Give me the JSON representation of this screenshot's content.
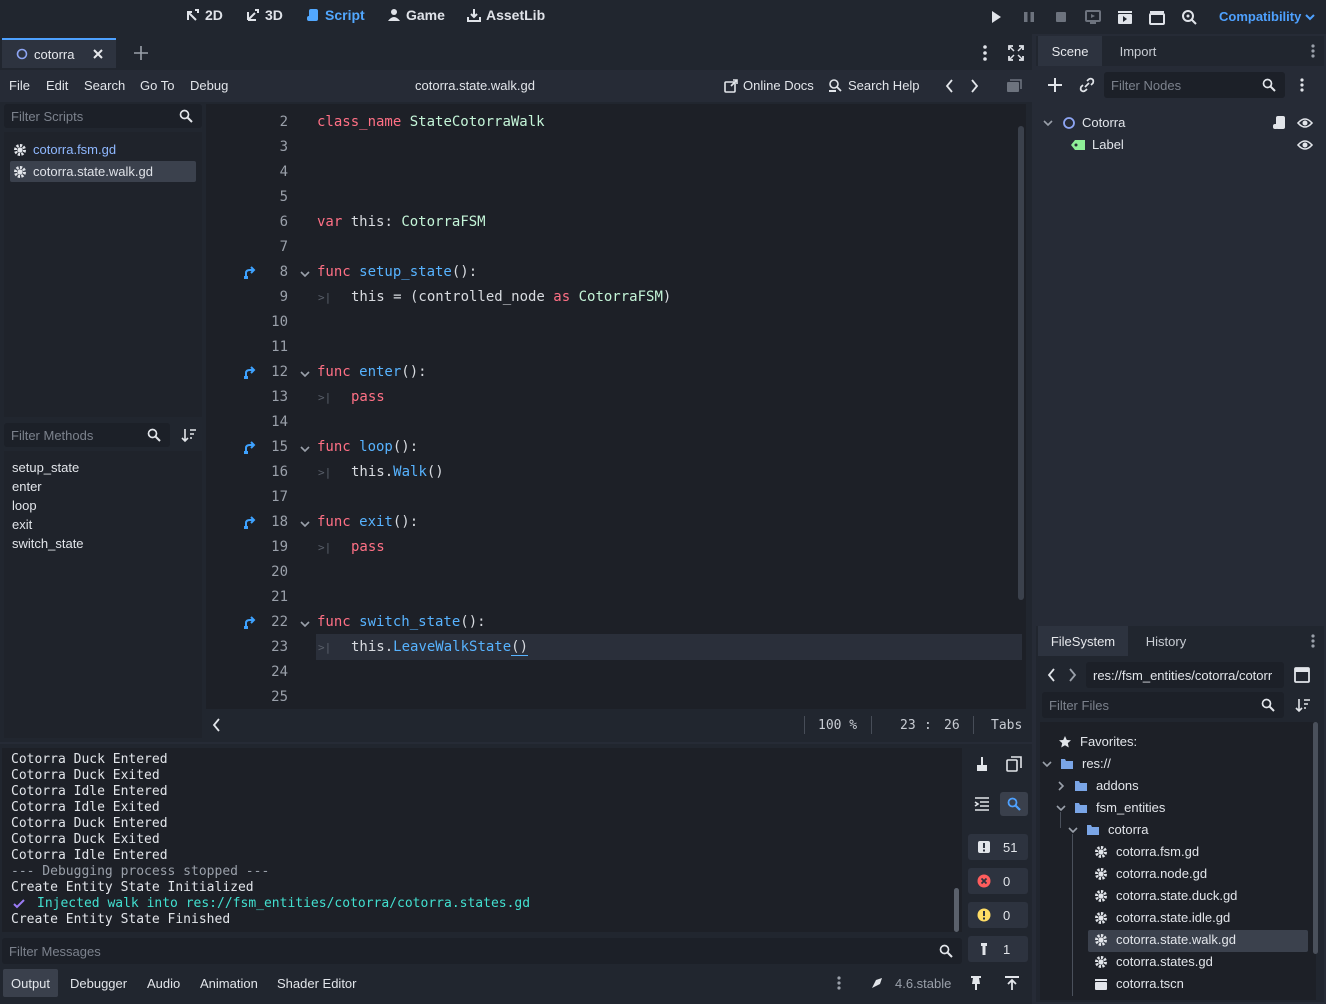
{
  "topbar": {
    "modes": [
      {
        "label": "2D",
        "icon": "2d-icon"
      },
      {
        "label": "3D",
        "icon": "3d-icon"
      },
      {
        "label": "Script",
        "icon": "script-icon"
      },
      {
        "label": "Game",
        "icon": "game-icon"
      },
      {
        "label": "AssetLib",
        "icon": "assetlib-icon"
      }
    ],
    "active_mode": "Script",
    "renderer": "Compatibility"
  },
  "script_editor": {
    "open_tab": "cotorra",
    "menu": [
      "File",
      "Edit",
      "Search",
      "Go To",
      "Debug"
    ],
    "current_file": "cotorra.state.walk.gd",
    "online_docs": "Online Docs",
    "search_help": "Search Help",
    "filter_scripts_placeholder": "Filter Scripts",
    "scripts": [
      "cotorra.fsm.gd",
      "cotorra.state.walk.gd"
    ],
    "filter_methods_placeholder": "Filter Methods",
    "methods": [
      "setup_state",
      "enter",
      "loop",
      "exit",
      "switch_state"
    ],
    "line_numbers": [
      "2",
      "3",
      "4",
      "5",
      "6",
      "7",
      "8",
      "9",
      "10",
      "11",
      "12",
      "13",
      "14",
      "15",
      "16",
      "17",
      "18",
      "19",
      "20",
      "21",
      "22",
      "23",
      "24",
      "25"
    ],
    "code": {
      "l2_kw": "class_name",
      "l2_name": " StateCotorraWalk",
      "l6_kw": "var",
      "l6_rest": " this: ",
      "l6_type": "CotorraFSM",
      "l8_kw": "func",
      "l8_fn": " setup_state",
      "l8_rest": "():",
      "l9_a": "this = (controlled_node ",
      "l9_as": "as",
      "l9_type": " CotorraFSM",
      "l9_end": ")",
      "l12_kw": "func",
      "l12_fn": " enter",
      "l12_rest": "():",
      "l13_kw": "pass",
      "l15_kw": "func",
      "l15_fn": " loop",
      "l15_rest": "():",
      "l16_a": "this.",
      "l16_fn": "Walk",
      "l16_end": "()",
      "l18_kw": "func",
      "l18_fn": " exit",
      "l18_rest": "():",
      "l19_kw": "pass",
      "l22_kw": "func",
      "l22_fn": " switch_state",
      "l22_rest": "():",
      "l23_a": "this.",
      "l23_fn": "LeaveWalkState",
      "l23_end": "()"
    },
    "status": {
      "zoom": "100 %",
      "line": "23",
      "sep": ":",
      "col": "26",
      "indent": "Tabs"
    }
  },
  "output": {
    "lines": [
      "Cotorra Duck Entered",
      "Cotorra Duck Exited",
      "Cotorra Idle Entered",
      "Cotorra Idle Exited",
      "Cotorra Duck Entered",
      "Cotorra Duck Exited",
      "Cotorra Idle Entered",
      "--- Debugging process stopped ---",
      "Create Entity State Initialized",
      "Injected walk into res://fsm_entities/cotorra/cotorra.states.gd",
      "Create Entity State Finished"
    ],
    "filter_placeholder": "Filter Messages",
    "counts": {
      "messages": "51",
      "errors": "0",
      "warnings": "0",
      "editor": "1"
    },
    "bottom_tabs": [
      "Output",
      "Debugger",
      "Audio",
      "Animation",
      "Shader Editor"
    ],
    "version": "4.6.stable",
    "colors": {
      "success": "#42e0d0",
      "error": "#ff5d5d",
      "warning": "#ffdd65"
    }
  },
  "scene": {
    "tabs": [
      "Scene",
      "Import"
    ],
    "filter_placeholder": "Filter Nodes",
    "nodes": [
      "Cotorra",
      "Label"
    ]
  },
  "filesystem": {
    "tabs": [
      "FileSystem",
      "History"
    ],
    "path": "res://fsm_entities/cotorra/cotorr",
    "filter_placeholder": "Filter Files",
    "favorites": "Favorites:",
    "root": "res://",
    "folders": [
      "addons",
      "fsm_entities",
      "cotorra"
    ],
    "files": [
      "cotorra.fsm.gd",
      "cotorra.node.gd",
      "cotorra.state.duck.gd",
      "cotorra.state.idle.gd",
      "cotorra.state.walk.gd",
      "cotorra.states.gd",
      "cotorra.tscn"
    ]
  }
}
